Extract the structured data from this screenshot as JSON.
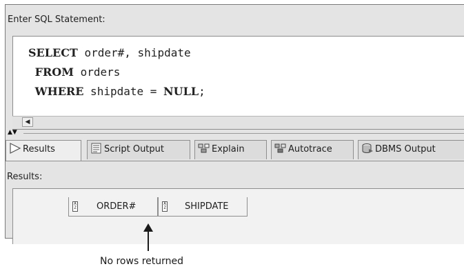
{
  "editor": {
    "label": "Enter SQL Statement:",
    "lines": [
      {
        "kw": "SELECT",
        "rest": " order#, shipdate"
      },
      {
        "kw": "FROM",
        "rest": " orders"
      },
      {
        "kw": "WHERE",
        "rest": " shipdate = ",
        "kw2": "NULL",
        "rest2": ";"
      }
    ]
  },
  "tabs": [
    {
      "label": "Results",
      "icon": "play-triangle-icon"
    },
    {
      "label": "Script Output",
      "icon": "script-document-icon"
    },
    {
      "label": "Explain",
      "icon": "explain-plan-icon"
    },
    {
      "label": "Autotrace",
      "icon": "autotrace-icon"
    },
    {
      "label": "DBMS Output",
      "icon": "dbms-output-icon"
    }
  ],
  "results": {
    "label": "Results:",
    "columns": [
      "ORDER#",
      "SHIPDATE"
    ]
  },
  "annotation": {
    "text": "No rows returned"
  }
}
